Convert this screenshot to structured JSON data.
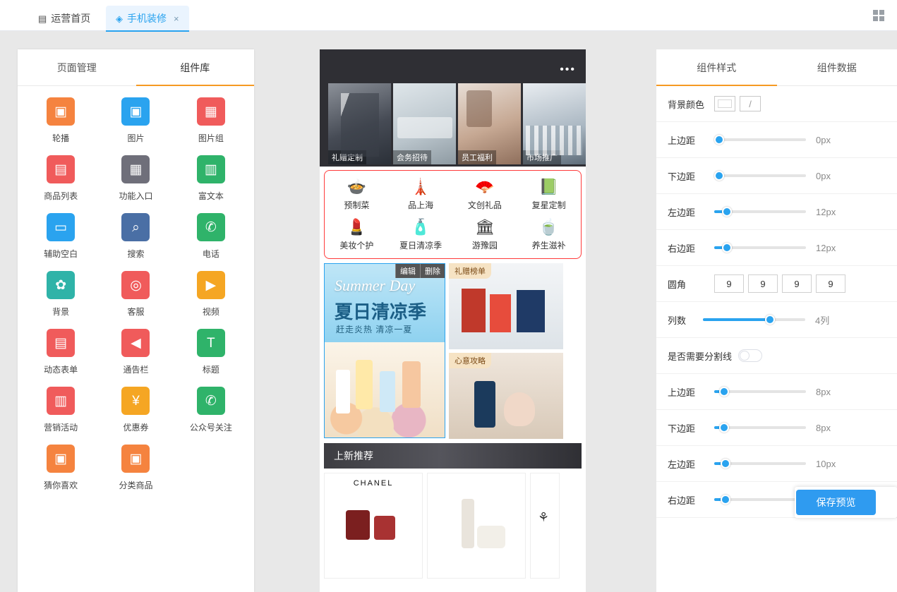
{
  "topbar": {
    "tabs": [
      {
        "label": "运营首页",
        "icon": "grid-icon",
        "active": false
      },
      {
        "label": "手机装修",
        "icon": "diamond-icon",
        "active": true,
        "close": "×"
      }
    ],
    "grid_toggle_icon": "grid-toggle-icon"
  },
  "left_panel": {
    "tabs": [
      {
        "label": "页面管理",
        "selected": false
      },
      {
        "label": "组件库",
        "selected": true
      }
    ],
    "components": [
      {
        "label": "轮播",
        "icon": "carousel-icon",
        "glyph": "▣",
        "color": "#f5833f"
      },
      {
        "label": "图片",
        "icon": "image-icon",
        "glyph": "▣",
        "color": "#2aa3ef"
      },
      {
        "label": "图片组",
        "icon": "image-group-icon",
        "glyph": "▦",
        "color": "#f05b5b"
      },
      {
        "label": "商品列表",
        "icon": "product-list-icon",
        "glyph": "▤",
        "color": "#f05b5b"
      },
      {
        "label": "功能入口",
        "icon": "entry-grid-icon",
        "glyph": "▦",
        "color": "#6f6f7a"
      },
      {
        "label": "富文本",
        "icon": "rich-text-icon",
        "glyph": "▥",
        "color": "#2fb36a"
      },
      {
        "label": "辅助空白",
        "icon": "blank-block-icon",
        "glyph": "▭",
        "color": "#2aa3ef"
      },
      {
        "label": "搜索",
        "icon": "search-icon",
        "glyph": "⌕",
        "color": "#4a6fa5"
      },
      {
        "label": "电话",
        "icon": "phone-icon",
        "glyph": "✆",
        "color": "#2fb36a"
      },
      {
        "label": "背景",
        "icon": "background-icon",
        "glyph": "✿",
        "color": "#2fb3a8"
      },
      {
        "label": "客服",
        "icon": "service-icon",
        "glyph": "◎",
        "color": "#f05b5b"
      },
      {
        "label": "视频",
        "icon": "video-icon",
        "glyph": "▶",
        "color": "#f5a623"
      },
      {
        "label": "动态表单",
        "icon": "form-icon",
        "glyph": "▤",
        "color": "#f05b5b"
      },
      {
        "label": "通告栏",
        "icon": "announce-icon",
        "glyph": "◀",
        "color": "#f05b5b"
      },
      {
        "label": "标题",
        "icon": "title-icon",
        "glyph": "T",
        "color": "#2fb36a"
      },
      {
        "label": "营销活动",
        "icon": "marketing-icon",
        "glyph": "▥",
        "color": "#f05b5b"
      },
      {
        "label": "优惠券",
        "icon": "coupon-icon",
        "glyph": "¥",
        "color": "#f5a623"
      },
      {
        "label": "公众号关注",
        "icon": "wechat-icon",
        "glyph": "✆",
        "color": "#2fb36a"
      },
      {
        "label": "猜你喜欢",
        "icon": "recommend-icon",
        "glyph": "▣",
        "color": "#f5833f"
      },
      {
        "label": "分类商品",
        "icon": "category-icon",
        "glyph": "▣",
        "color": "#f5833f"
      }
    ]
  },
  "canvas": {
    "banner": {
      "more_icon": "more-dots-icon",
      "images": [
        {
          "caption": "礼赠定制"
        },
        {
          "caption": "会务招待"
        },
        {
          "caption": "员工福利"
        },
        {
          "caption": "市场推广"
        }
      ]
    },
    "nav_block": {
      "items": [
        {
          "label": "预制菜",
          "icon": "bowl-icon",
          "glyph": "🍲"
        },
        {
          "label": "品上海",
          "icon": "tower-icon",
          "glyph": "🗼"
        },
        {
          "label": "文创礼品",
          "icon": "fan-icon",
          "glyph": "🪭"
        },
        {
          "label": "复星定制",
          "icon": "book-icon",
          "glyph": "📗"
        },
        {
          "label": "美妆个护",
          "icon": "cosmetic-icon",
          "glyph": "💄"
        },
        {
          "label": "夏日清凉季",
          "icon": "bottle-icon",
          "glyph": "🧴"
        },
        {
          "label": "游豫园",
          "icon": "temple-icon",
          "glyph": "🏛"
        },
        {
          "label": "养生滋补",
          "icon": "teacup-icon",
          "glyph": "🍵"
        }
      ]
    },
    "promo": {
      "selected_card": {
        "edit_label": "编辑",
        "delete_label": "删除",
        "title_en": "Summer Day",
        "title_cn": "夏日清凉季",
        "subtitle": "赶走炎热 清凉一夏"
      },
      "cards": [
        {
          "tag": "礼赠榜单"
        },
        {
          "tag": "心意攻略"
        }
      ]
    },
    "section_title": "上新推荐",
    "products": [
      {
        "brand": "CHANEL"
      },
      {
        "brand": ""
      },
      {
        "brand": ""
      }
    ]
  },
  "right_panel": {
    "tabs": [
      {
        "label": "组件样式",
        "selected": true
      },
      {
        "label": "组件数据",
        "selected": false
      }
    ],
    "props": [
      {
        "name": "bg-color",
        "label": "背景颜色",
        "type": "color",
        "value": "#ffffff",
        "alt": "/"
      },
      {
        "name": "margin-top-1",
        "label": "上边距",
        "type": "slider",
        "value": "0px",
        "pct": 3
      },
      {
        "name": "margin-bottom-1",
        "label": "下边距",
        "type": "slider",
        "value": "0px",
        "pct": 3
      },
      {
        "name": "margin-left-1",
        "label": "左边距",
        "type": "slider",
        "value": "12px",
        "pct": 12
      },
      {
        "name": "margin-right-1",
        "label": "右边距",
        "type": "slider",
        "value": "12px",
        "pct": 12
      },
      {
        "name": "border-radius",
        "label": "圆角",
        "type": "corners",
        "values": [
          "9",
          "9",
          "9",
          "9"
        ]
      },
      {
        "name": "columns",
        "label": "列数",
        "type": "slider",
        "value": "4列",
        "pct": 65
      },
      {
        "name": "divider",
        "label": "是否需要分割线",
        "type": "switch",
        "value": "off"
      },
      {
        "name": "margin-top-2",
        "label": "上边距",
        "type": "slider",
        "value": "8px",
        "pct": 9
      },
      {
        "name": "margin-bottom-2",
        "label": "下边距",
        "type": "slider",
        "value": "8px",
        "pct": 9
      },
      {
        "name": "margin-left-2",
        "label": "左边距",
        "type": "slider",
        "value": "10px",
        "pct": 11
      },
      {
        "name": "margin-right-2",
        "label": "右边距",
        "type": "slider",
        "value": "",
        "pct": 11
      }
    ],
    "save_button": "保存预览"
  },
  "colors": {
    "accent_blue": "#2aa3ef",
    "accent_orange": "#f59a23",
    "selected_red": "#ff3b3b",
    "save_blue": "#2f9bf0"
  }
}
